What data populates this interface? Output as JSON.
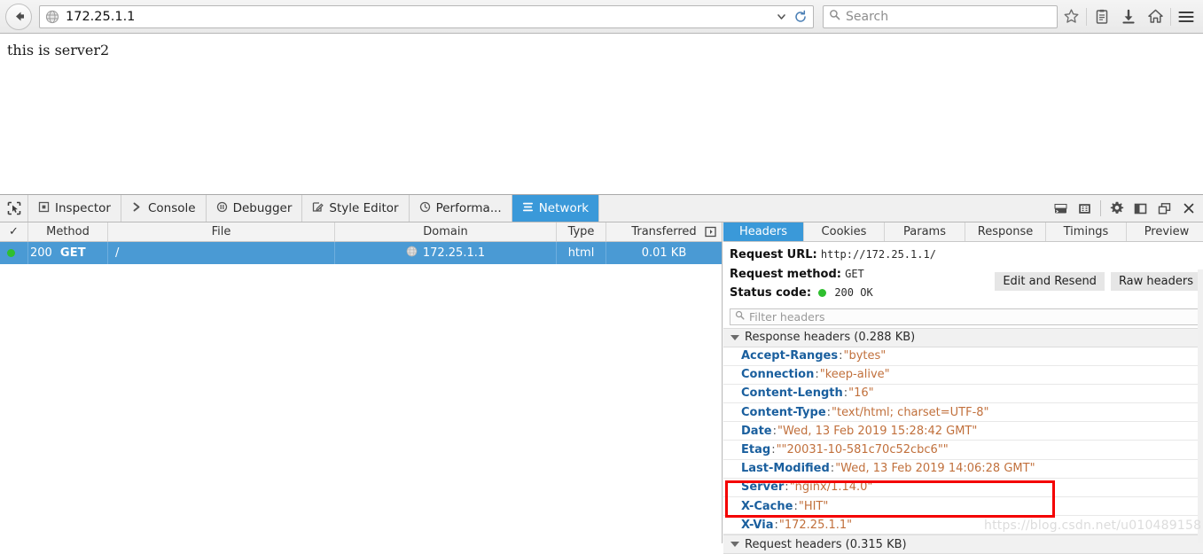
{
  "browser": {
    "back_icon": "back-arrow-icon",
    "favicon": "globe-icon",
    "url": "172.25.1.1",
    "url_dropdown_icon": "chevron-down-icon",
    "reload_icon": "reload-icon",
    "search_placeholder": "Search",
    "search_icon": "search-icon",
    "toolbar_icons": [
      "star-icon",
      "library-icon",
      "downloads-icon",
      "home-icon",
      "menu-icon"
    ]
  },
  "page": {
    "body_text": "this is server2"
  },
  "devtools": {
    "picker_icon": "element-picker-icon",
    "tabs": [
      {
        "label": "Inspector",
        "icon": "inspector-icon",
        "active": false
      },
      {
        "label": "Console",
        "icon": "console-icon",
        "active": false
      },
      {
        "label": "Debugger",
        "icon": "debugger-icon",
        "active": false
      },
      {
        "label": "Style Editor",
        "icon": "style-editor-icon",
        "active": false
      },
      {
        "label": "Performa...",
        "icon": "performance-icon",
        "active": false
      },
      {
        "label": "Network",
        "icon": "network-icon",
        "active": true
      }
    ],
    "right_icons": [
      "split-console-icon",
      "responsive-design-icon",
      "settings-gear-icon",
      "dock-side-icon",
      "dock-window-icon",
      "close-icon"
    ]
  },
  "network": {
    "columns": [
      "✓",
      "Method",
      "File",
      "Domain",
      "Type",
      "Transferred"
    ],
    "column_menu_icon": "column-picker-icon",
    "rows": [
      {
        "status_dot": "green",
        "status": "200",
        "method": "GET",
        "file": "/",
        "domain_icon": "globe-icon",
        "domain": "172.25.1.1",
        "type": "html",
        "transferred": "0.01 KB",
        "selected": true
      }
    ]
  },
  "details": {
    "tabs": [
      {
        "label": "Headers",
        "active": true
      },
      {
        "label": "Cookies",
        "active": false
      },
      {
        "label": "Params",
        "active": false
      },
      {
        "label": "Response",
        "active": false
      },
      {
        "label": "Timings",
        "active": false
      },
      {
        "label": "Preview",
        "active": false
      }
    ],
    "summary": {
      "request_url_label": "Request URL:",
      "request_url_value": "http://172.25.1.1/",
      "request_method_label": "Request method:",
      "request_method_value": "GET",
      "status_code_label": "Status code:",
      "status_code_value": "200 OK",
      "status_dot_color": "#2fbf2f"
    },
    "buttons": {
      "edit_resend": "Edit and Resend",
      "raw_headers": "Raw headers"
    },
    "filter": {
      "placeholder": "Filter headers",
      "icon": "search-icon"
    },
    "response_section": {
      "title": "Response headers (0.288 KB)",
      "headers": [
        {
          "name": "Accept-Ranges",
          "value": "\"bytes\""
        },
        {
          "name": "Connection",
          "value": "\"keep-alive\""
        },
        {
          "name": "Content-Length",
          "value": "\"16\""
        },
        {
          "name": "Content-Type",
          "value": "\"text/html; charset=UTF-8\""
        },
        {
          "name": "Date",
          "value": "\"Wed, 13 Feb 2019 15:28:42 GMT\""
        },
        {
          "name": "Etag",
          "value": "\"\"20031-10-581c70c52cbc6\"\""
        },
        {
          "name": "Last-Modified",
          "value": "\"Wed, 13 Feb 2019 14:06:28 GMT\""
        },
        {
          "name": "Server",
          "value": "\"nginx/1.14.0\""
        },
        {
          "name": "X-Cache",
          "value": "\"HIT\""
        },
        {
          "name": "X-Via",
          "value": "\"172.25.1.1\""
        }
      ]
    },
    "request_section": {
      "title": "Request headers (0.315 KB)"
    }
  },
  "annotation": {
    "highlight_color": "#f40000",
    "watermark": "https://blog.csdn.net/u010489158"
  }
}
